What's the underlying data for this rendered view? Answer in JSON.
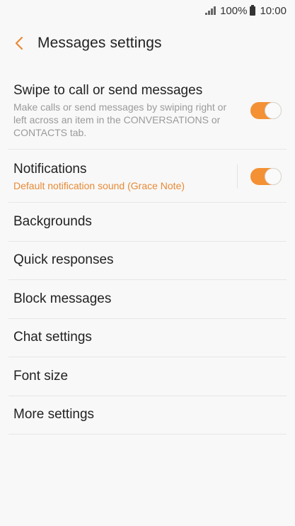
{
  "status": {
    "battery": "100%",
    "time": "10:00"
  },
  "header": {
    "title": "Messages settings"
  },
  "swipe": {
    "title": "Swipe to call or send messages",
    "description": "Make calls or send messages by swiping right or left across an item in the CONVERSATIONS or CONTACTS tab.",
    "enabled": true
  },
  "notifications": {
    "title": "Notifications",
    "subtitle": "Default notification sound (Grace Note)",
    "enabled": true
  },
  "items": [
    {
      "label": "Backgrounds"
    },
    {
      "label": "Quick responses"
    },
    {
      "label": "Block messages"
    },
    {
      "label": "Chat settings"
    },
    {
      "label": "Font size"
    },
    {
      "label": "More settings"
    }
  ],
  "colors": {
    "accent": "#f39134",
    "subtitle_accent": "#e88a36"
  },
  "icons": {
    "back": "chevron-left-icon",
    "signal": "signal-icon",
    "battery": "battery-icon"
  }
}
